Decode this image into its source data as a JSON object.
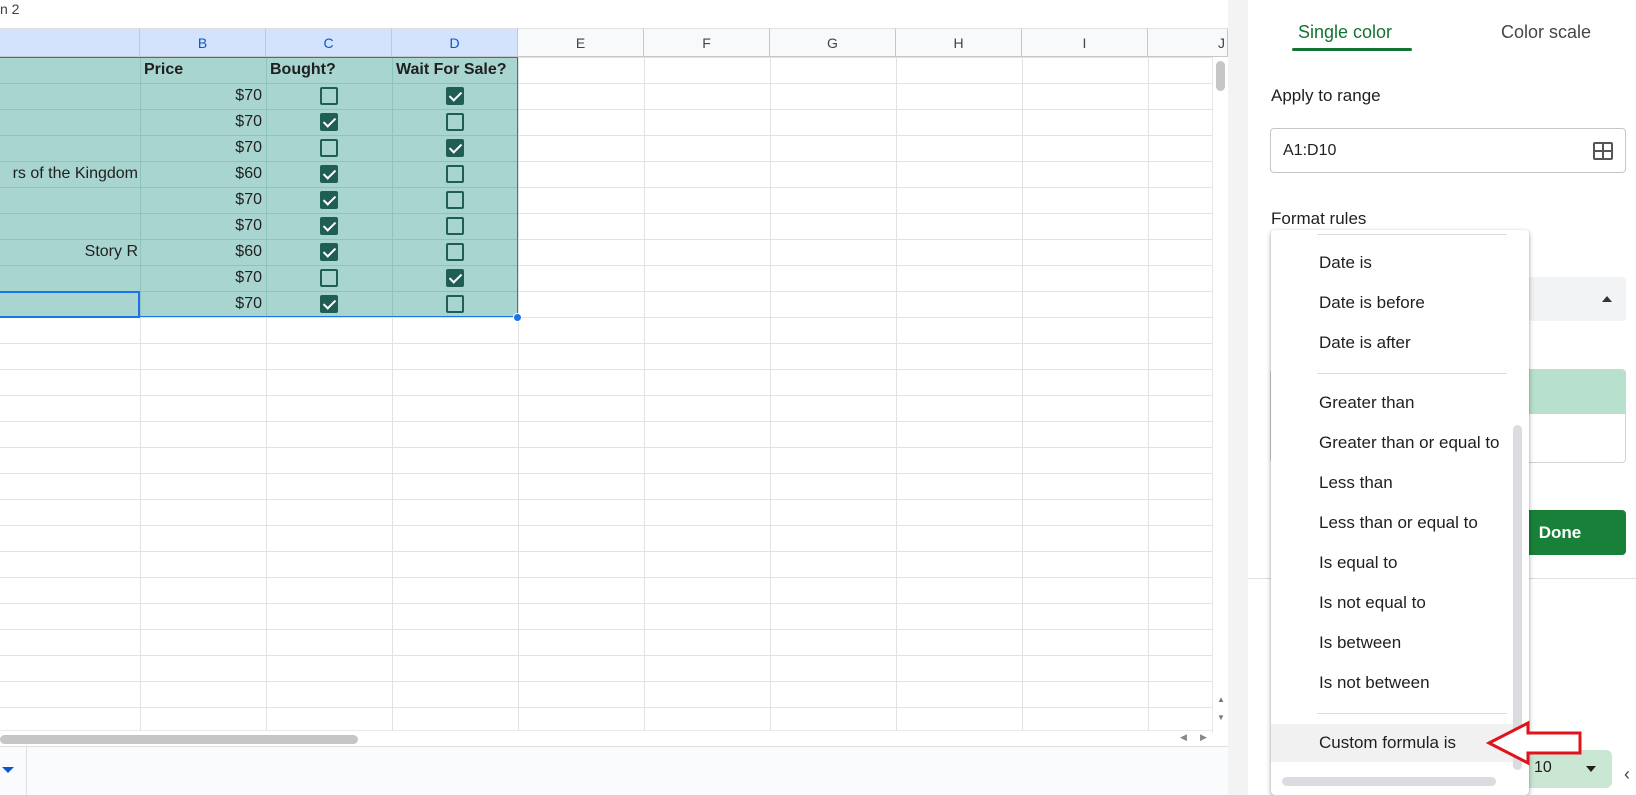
{
  "sheet": {
    "top_label": "n 2",
    "columns": [
      "B",
      "C",
      "D",
      "E",
      "F",
      "G",
      "H",
      "I",
      "J"
    ],
    "headers": {
      "b": "Price",
      "c": "Bought?",
      "d": "Wait For Sale?"
    },
    "rows": [
      {
        "a": "",
        "price": "$70",
        "bought": false,
        "wait": true
      },
      {
        "a": "",
        "price": "$70",
        "bought": true,
        "wait": false
      },
      {
        "a": "",
        "price": "$70",
        "bought": false,
        "wait": true
      },
      {
        "a": "rs of the Kingdom",
        "price": "$60",
        "bought": true,
        "wait": false
      },
      {
        "a": "",
        "price": "$70",
        "bought": true,
        "wait": false
      },
      {
        "a": "",
        "price": "$70",
        "bought": true,
        "wait": false
      },
      {
        "a": "Story R",
        "price": "$60",
        "bought": true,
        "wait": false
      },
      {
        "a": "",
        "price": "$70",
        "bought": false,
        "wait": true
      },
      {
        "a": "",
        "price": "$70",
        "bought": true,
        "wait": false
      }
    ]
  },
  "panel": {
    "tabs": {
      "single": "Single color",
      "scale": "Color scale"
    },
    "apply_to_range_label": "Apply to range",
    "range_value": "A1:D10",
    "format_rules_label": "Format rules",
    "done_label": "Done",
    "bottom_chip_text": "10"
  },
  "dropdown": {
    "items": [
      "Date is",
      "Date is before",
      "Date is after",
      "Greater than",
      "Greater than or equal to",
      "Less than",
      "Less than or equal to",
      "Is equal to",
      "Is not equal to",
      "Is between",
      "Is not between",
      "Custom formula is"
    ],
    "hovered": "Custom formula is"
  },
  "colors": {
    "selection_fill": "#a8d5d0",
    "checkbox": "#1e5e55",
    "accent_green": "#137333",
    "done_button": "#188038",
    "annotation_arrow": "#e0121b"
  }
}
